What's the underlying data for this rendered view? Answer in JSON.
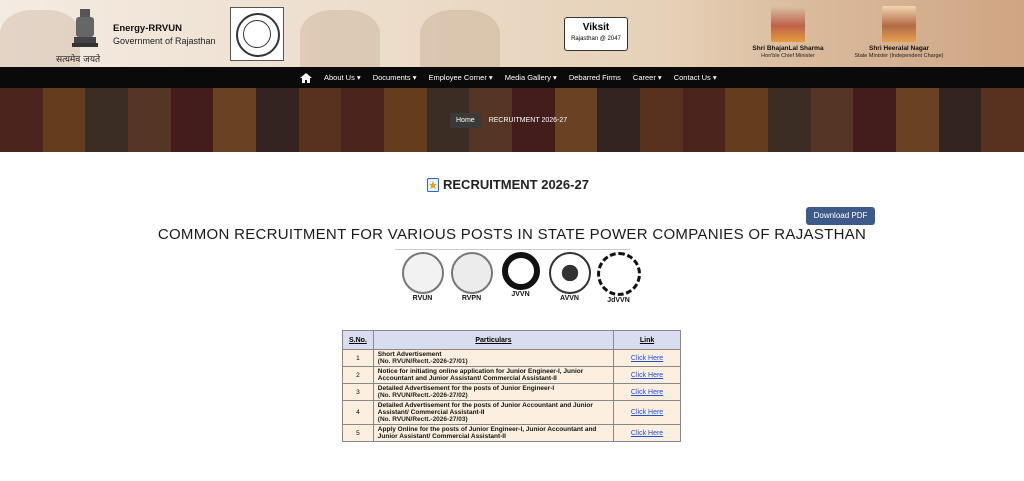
{
  "header": {
    "emblem_caption": "सत्यमेव जयते",
    "org_name": "Energy-RRVUN",
    "org_sub": "Government of Rajasthan",
    "viksit_title": "Viksit",
    "viksit_sub": "Rajasthan @ 2047",
    "people": [
      {
        "name": "Shri BhajanLal Sharma",
        "role": "Hon'ble Chief Minister"
      },
      {
        "name": "Shri Heeralal Nagar",
        "role": "State Minister (Independent Charge)"
      }
    ]
  },
  "nav": {
    "items": [
      "About Us ▾",
      "Documents ▾",
      "Employee Corner ▾",
      "Media Gallery ▾",
      "Debarred Firms",
      "Career ▾",
      "Contact Us ▾"
    ]
  },
  "breadcrumb": {
    "home": "Home",
    "current": "RECRUITMENT 2026-27"
  },
  "page": {
    "title": "RECRUITMENT 2026-27",
    "download_pdf": "Download PDF",
    "heading": "COMMON RECRUITMENT FOR VARIOUS POSTS IN STATE POWER COMPANIES OF RAJASTHAN",
    "logos": [
      "RVUN",
      "RVPN",
      "JVVN",
      "AVVN",
      "JdVVN"
    ]
  },
  "table": {
    "headers": [
      "S.No.",
      "Particulars",
      "Link"
    ],
    "rows": [
      {
        "sno": "1",
        "title": "Short Advertisement",
        "ref": "(No. RVUN/Rectt.-2026-27/01)",
        "link": "Click Here"
      },
      {
        "sno": "2",
        "title": "Notice for initiating online application for Junior Engineer-I, Junior Accountant and Junior Assistant/ Commercial Assistant-II",
        "ref": "",
        "link": "Click Here"
      },
      {
        "sno": "3",
        "title": "Detailed Advertisement for the posts of Junior Engineer-I",
        "ref": "(No. RVUN/Rectt.-2026-27/02)",
        "link": "Click Here"
      },
      {
        "sno": "4",
        "title": "Detailed Advertisement for the posts of Junior Accountant and Junior Assistant/ Commercial Assistant-II",
        "ref": "(No. RVUN/Rectt.-2026-27/03)",
        "link": "Click Here"
      },
      {
        "sno": "5",
        "title": "Apply Online for the posts of Junior Engineer-I, Junior Accountant and Junior Assistant/ Commercial Assistant-II",
        "ref": "",
        "link": "Click Here"
      }
    ]
  },
  "colors": {
    "navbar": "#0a0a0a",
    "pdf_button": "#3d5a8a",
    "table_header": "#d9ddf0",
    "table_cell": "#fcefdf",
    "link": "#1f4fd6"
  }
}
